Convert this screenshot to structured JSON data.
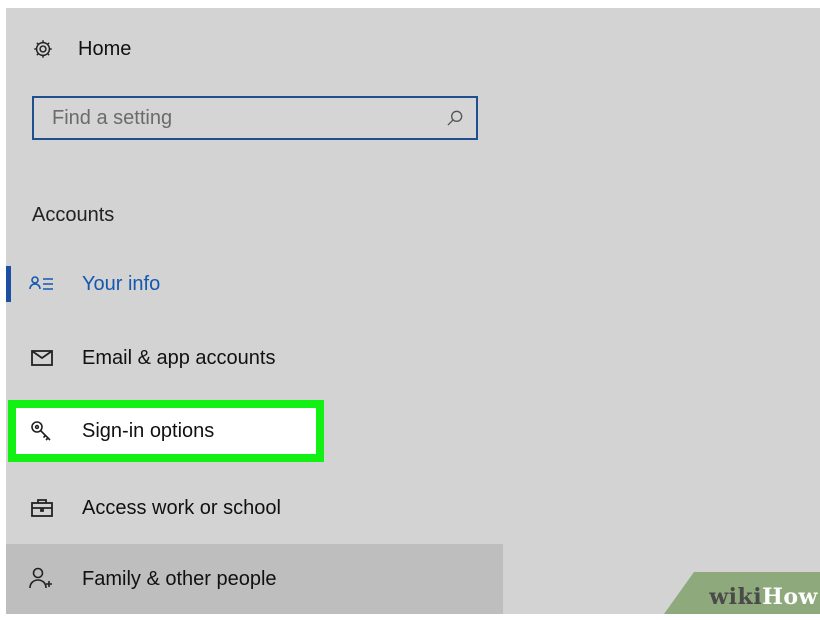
{
  "home": {
    "label": "Home",
    "icon": "gear-icon"
  },
  "search": {
    "placeholder": "Find a setting",
    "icon": "search-icon"
  },
  "section": {
    "title": "Accounts"
  },
  "nav": {
    "items": [
      {
        "label": "Your info",
        "icon": "person-list-icon",
        "selected": true
      },
      {
        "label": "Email & app accounts",
        "icon": "mail-icon"
      },
      {
        "label": "Sign-in options",
        "icon": "key-icon",
        "highlighted": true
      },
      {
        "label": "Access work or school",
        "icon": "briefcase-icon"
      },
      {
        "label": "Family & other people",
        "icon": "person-add-icon",
        "hovered": true
      }
    ]
  },
  "watermark": {
    "part1": "wiki",
    "part2": "How"
  },
  "colors": {
    "panel_bg": "#d3d3d3",
    "accent_blue": "#1558b0",
    "highlight_green": "#13f013",
    "hover_bg": "#bebebe",
    "watermark_bg": "#8ea97b"
  }
}
